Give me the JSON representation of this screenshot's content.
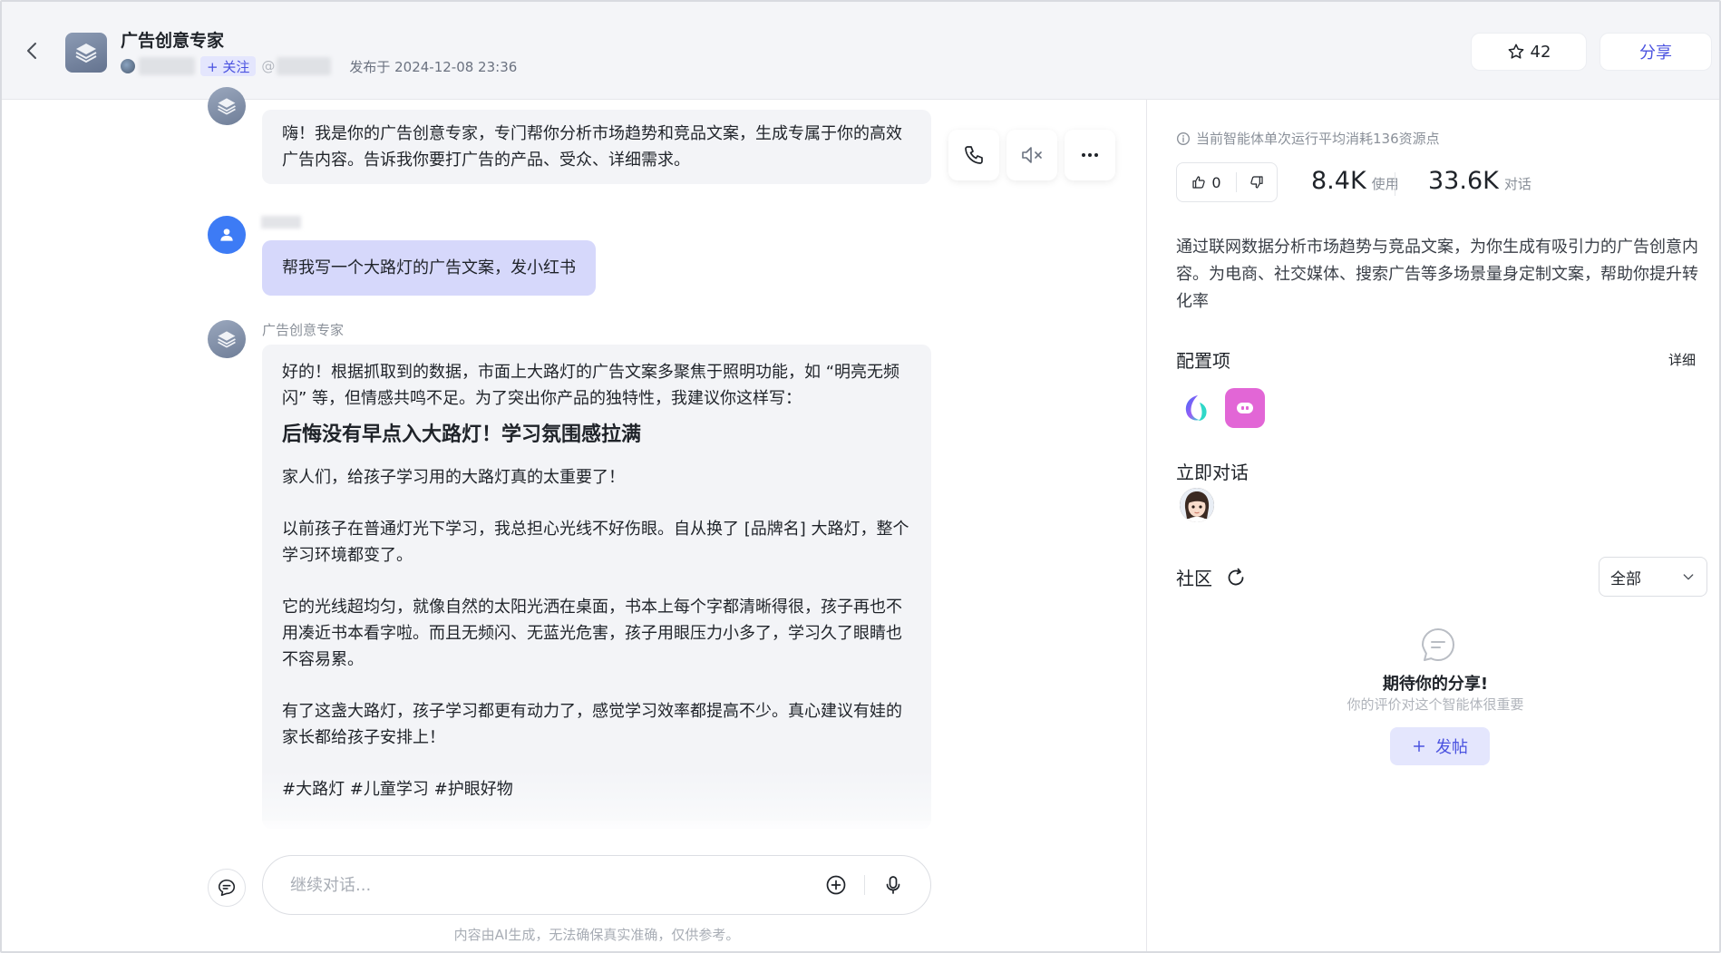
{
  "header": {
    "agent_name": "广告创意专家",
    "follow_label": "+ 关注",
    "at_prefix": "@",
    "publish_time": "发布于 2024-12-08 23:36",
    "favorites_count": "42",
    "share_label": "分享"
  },
  "chat": {
    "greeting": "嗨！我是你的广告创意专家，专门帮你分析市场趋势和竞品文案，生成专属于你的高效广告内容。告诉我你要打广告的产品、受众、详细需求。",
    "user_message": "帮我写一个大路灯的广告文案，发小红书",
    "reply_sender": "广告创意专家",
    "reply": {
      "intro": "好的！根据抓取到的数据，市面上大路灯的广告文案多聚焦于照明功能，如 “明亮无频闪” 等，但情感共鸣不足。为了突出你产品的独特性，我建议你这样写：",
      "headline": "后悔没有早点入大路灯！学习氛围感拉满",
      "p1": "家人们，给孩子学习用的大路灯真的太重要了！",
      "p2": "以前孩子在普通灯光下学习，我总担心光线不好伤眼。自从换了 [品牌名] 大路灯，整个学习环境都变了。",
      "p3": "它的光线超均匀，就像自然的太阳光洒在桌面，书本上每个字都清晰得很，孩子再也不用凑近书本看字啦。而且无频闪、无蓝光危害，孩子用眼压力小多了，学习久了眼睛也不容易累。",
      "p4": "有了这盏大路灯，孩子学习都更有动力了，感觉学习效率都提高不少。真心建议有娃的家长都给孩子安排上！",
      "tags": "#大路灯 #儿童学习 #护眼好物"
    },
    "input_placeholder": "继续对话...",
    "disclaimer": "内容由AI生成，无法确保真实准确，仅供参考。"
  },
  "panel": {
    "cost_note": "当前智能体单次运行平均消耗136资源点",
    "likes": "0",
    "usage_count": "8.4K",
    "usage_unit": "使用",
    "dialog_count": "33.6K",
    "dialog_unit": "对话",
    "description": "通过联网数据分析市场趋势与竞品文案，为你生成有吸引力的广告创意内容。为电商、社交媒体、搜索广告等多场景量身定制文案，帮助你提升转化率",
    "config_title": "配置项",
    "detail_label": "详细",
    "talk_title": "立即对话",
    "community_title": "社区",
    "filter_value": "全部",
    "empty_title": "期待你的分享!",
    "empty_subtitle": "你的评价对这个智能体很重要",
    "post_label": "发帖"
  },
  "colors": {
    "accent": "#4a52e0",
    "accent_light": "#e4e6fd",
    "user_bubble": "#d6d8fb",
    "bot_bubble": "#f3f4f7",
    "user_avatar": "#3d7bf5"
  },
  "icons": [
    "back-arrow-icon",
    "layers-icon",
    "star-icon",
    "phone-icon",
    "mute-icon",
    "more-icon",
    "user-icon",
    "chat-tool-icon",
    "add-circle-icon",
    "microphone-icon",
    "info-icon",
    "thumb-up-icon",
    "thumb-down-icon",
    "refresh-icon",
    "chevron-down-icon",
    "empty-chat-icon",
    "plus-icon"
  ]
}
